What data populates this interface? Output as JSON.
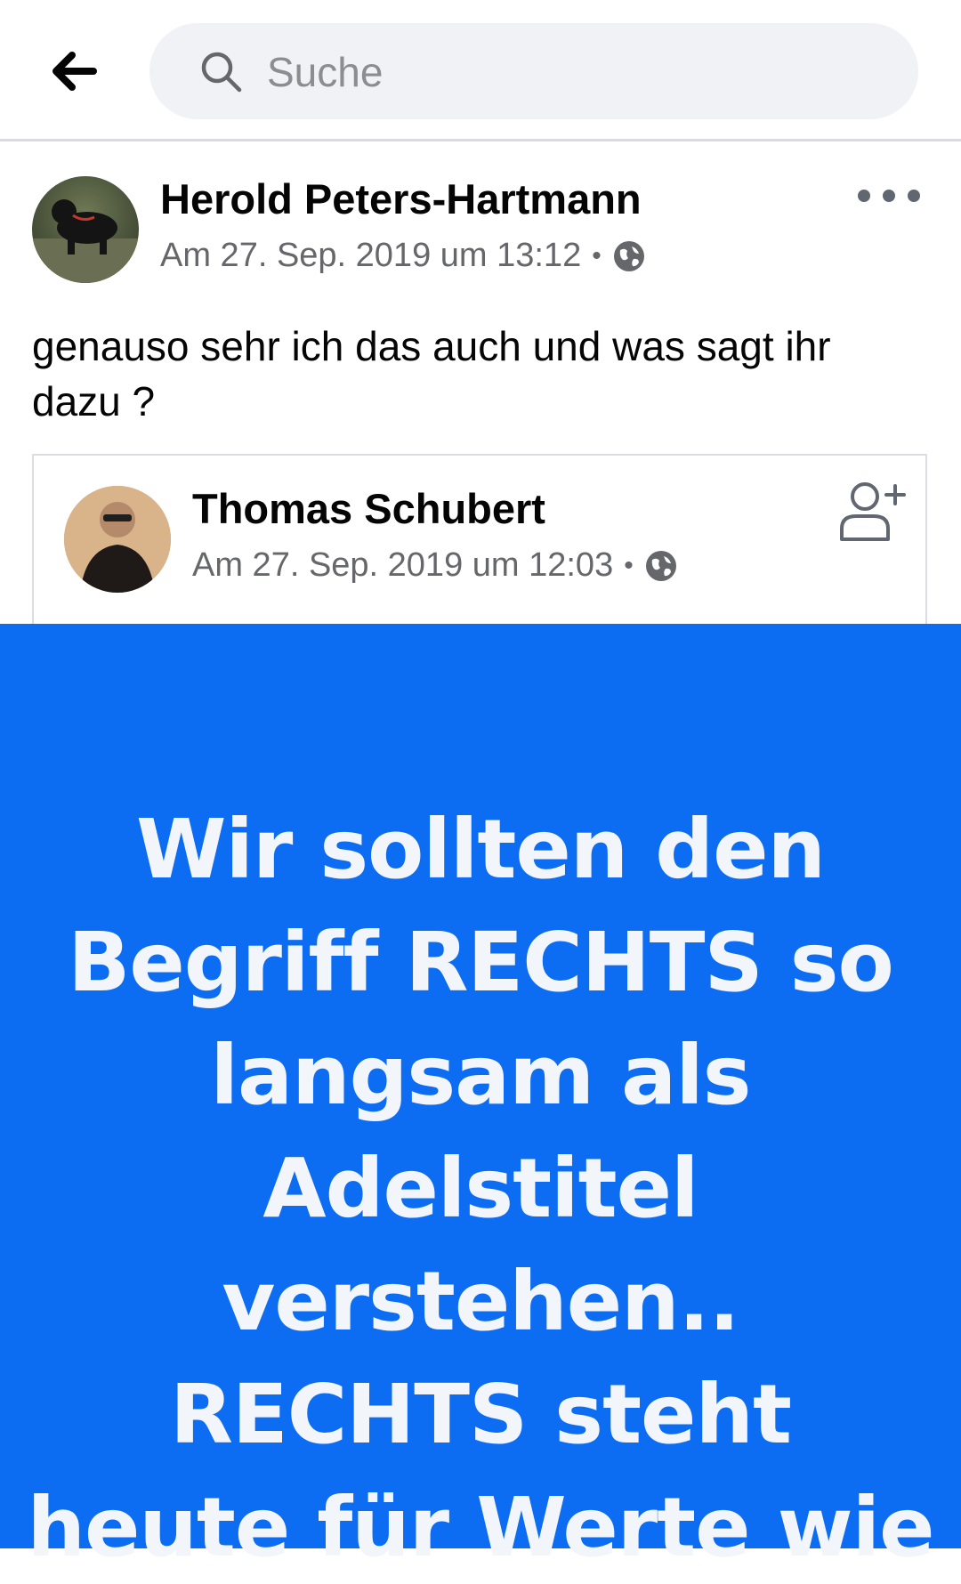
{
  "search": {
    "placeholder": "Suche"
  },
  "post": {
    "author": "Herold Peters-Hartmann",
    "timestamp": "Am 27. Sep. 2019 um 13:12",
    "audience_icon": "globe-icon",
    "text": "genauso sehr ich das auch und was sagt ihr dazu ?"
  },
  "shared": {
    "author": "Thomas Schubert",
    "timestamp": "Am 27. Sep. 2019 um 12:03",
    "audience_icon": "globe-icon",
    "image_lines": [
      "Wir sollten den",
      "Begriff RECHTS so",
      "langsam als",
      "Adelstitel",
      "verstehen..",
      "RECHTS steht",
      "heute für Werte wie"
    ],
    "image_background": "#0d6df2"
  },
  "icons": {
    "back": "arrow-left-icon",
    "search": "search-icon",
    "more": "more-icon",
    "add_friend": "add-friend-icon"
  }
}
